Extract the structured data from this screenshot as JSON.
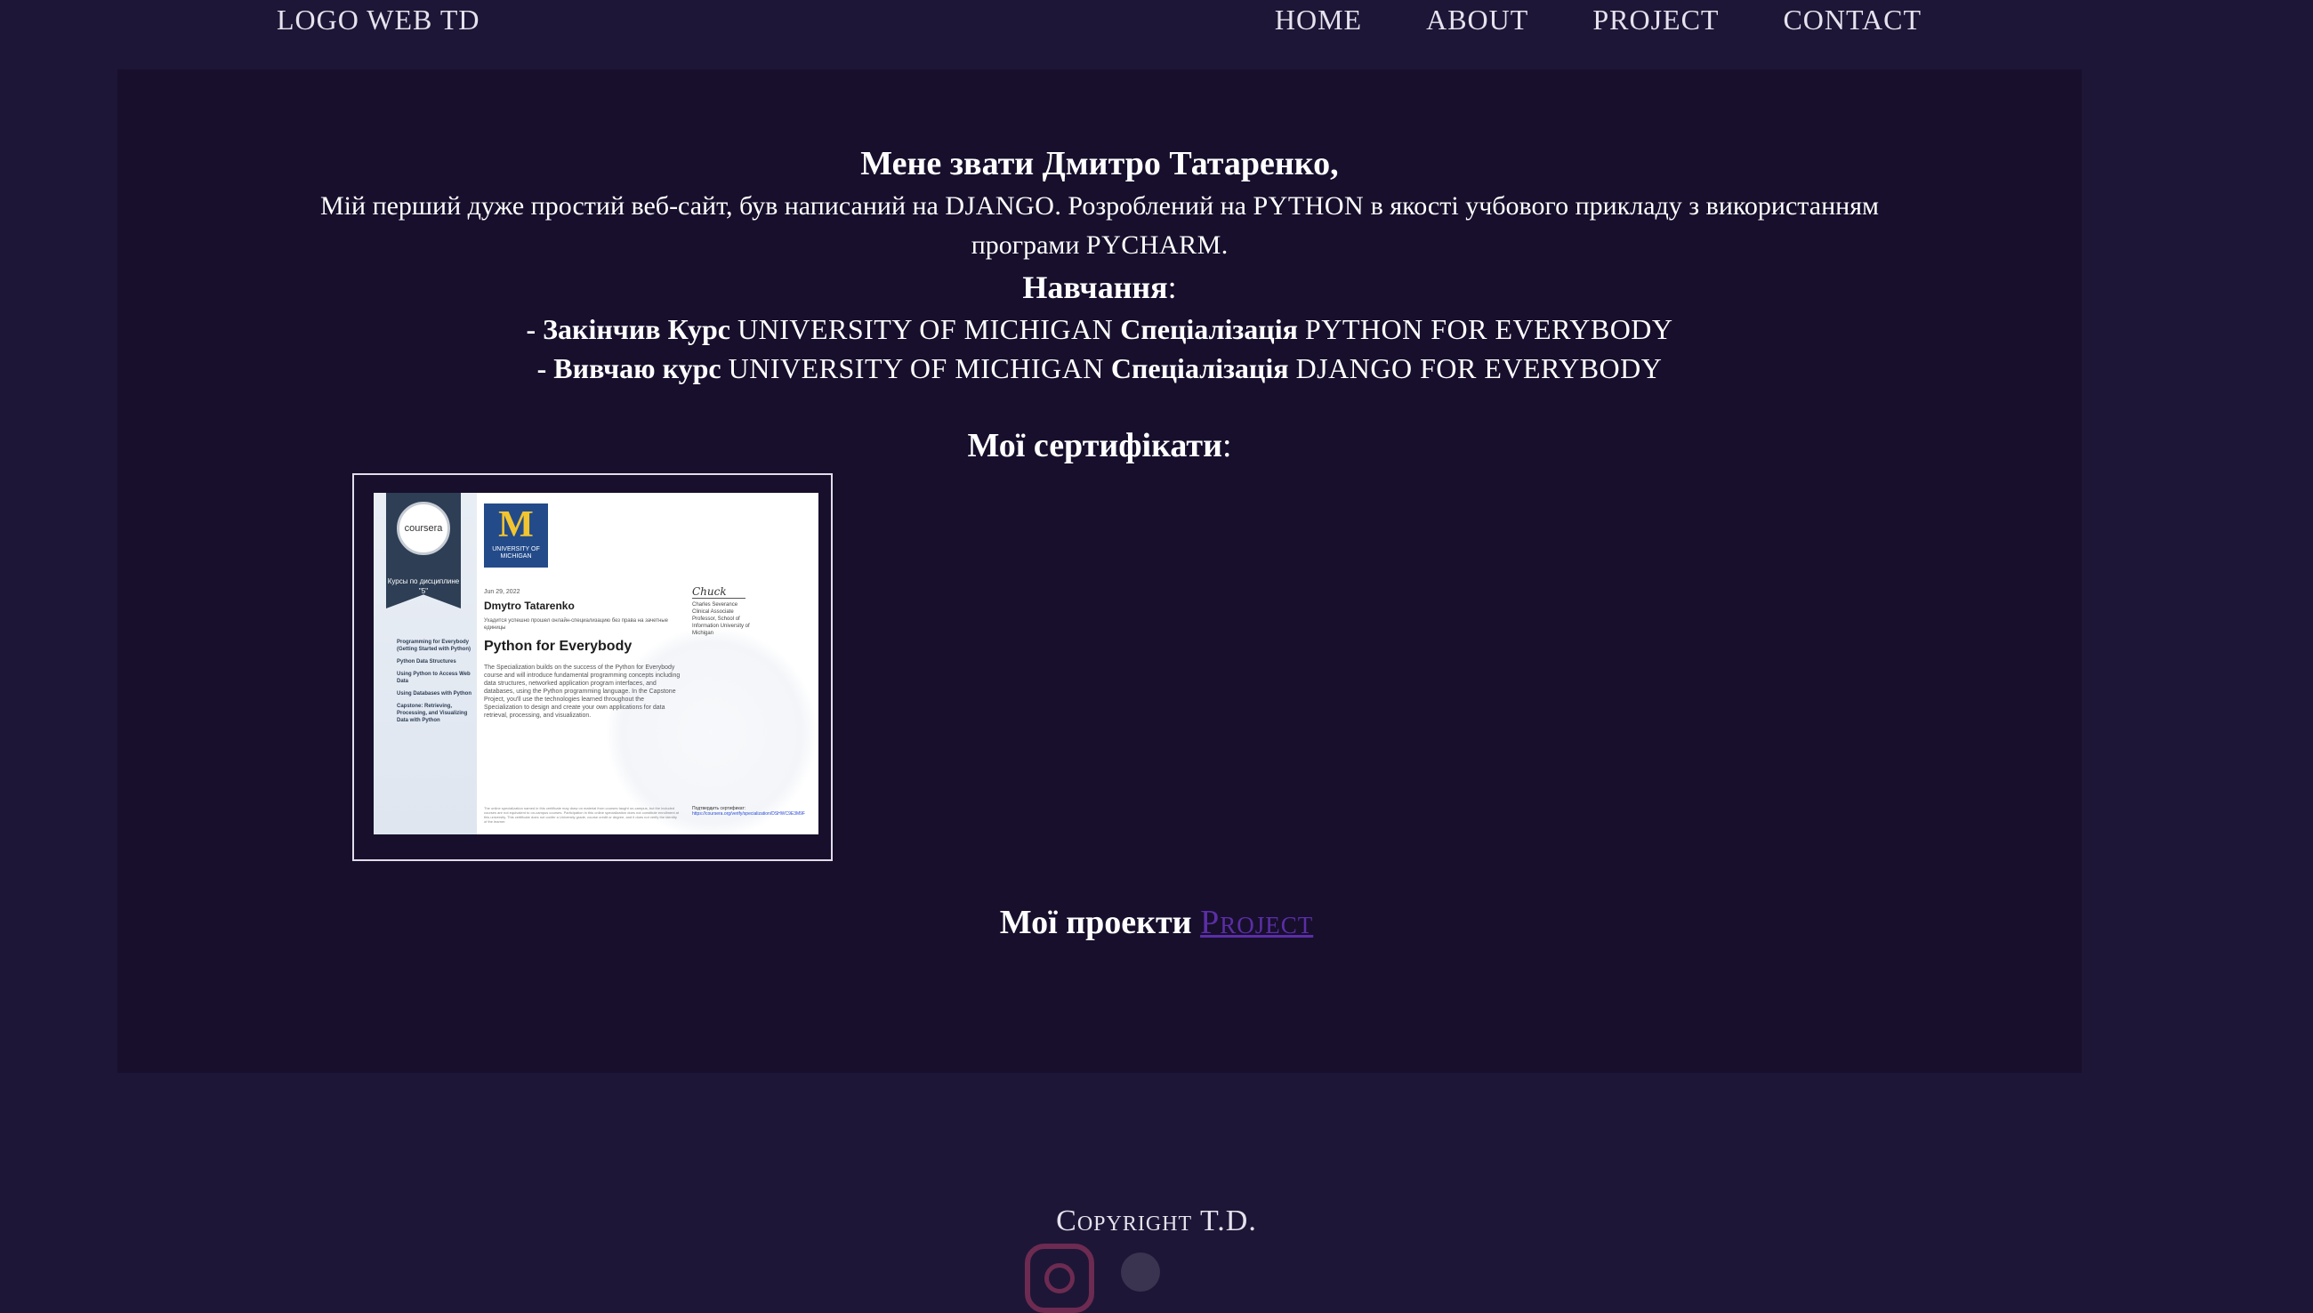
{
  "nav": {
    "logo": "LOGO WEB TD",
    "links": [
      "HOME",
      "ABOUT",
      "PROJECT",
      "CONTACT"
    ]
  },
  "intro": {
    "name_line": "Мене звати Дмитро Татаренко,",
    "desc_part1": "Мій перший дуже простий веб-сайт, був написаний на ",
    "desc_django": "DJANGO",
    "desc_part2": ". Розроблений на ",
    "desc_python": "PYTHON",
    "desc_part3": " в якості учбового прикладу з використанням програми ",
    "desc_pycharm": "PYCHARM",
    "desc_end": ".",
    "study_title": "Навчання",
    "study_colon": ":",
    "course1_prefix": "- Закінчив Курс ",
    "course1_uni": "UNIVERSITY OF MICHIGAN",
    "course1_spec": " Спеціалізація ",
    "course1_name": "PYTHON FOR EVERYBODY",
    "course2_prefix": "- Вивчаю курс ",
    "course2_uni": "UNIVERSITY OF MICHIGAN",
    "course2_spec": " Спеціалізація ",
    "course2_name": "DJANGO FOR EVERYBODY"
  },
  "certificates": {
    "title": "Мої сертифікати",
    "colon": ":",
    "cert": {
      "seal_text": "coursera",
      "ribbon_text": "Курсы по дисциплине \"5\"",
      "courses": [
        "Programming for Everybody (Getting Started with Python)",
        "Python Data Structures",
        "Using Python to Access Web Data",
        "Using Databases with Python",
        "Capstone: Retrieving, Processing, and Visualizing Data with Python"
      ],
      "logo_letter": "M",
      "logo_text": "UNIVERSITY OF MICHIGAN",
      "date": "Jun 29, 2022",
      "person": "Dmytro Tatarenko",
      "subtitle": "Ухадится успешно прошел онлайн-специализацию без права на зачетные единицы",
      "course": "Python for Everybody",
      "body": "The Specialization builds on the success of the Python for Everybody course and will introduce fundamental programming concepts including data structures, networked application program interfaces, and databases, using the Python programming language. In the Capstone Project, you'll use the technologies learned throughout the Specialization to design and create your own applications for data retrieval, processing, and visualization.",
      "signature": "Chuck",
      "signer": "Charles Severance Clinical Associate Professor, School of Information University of Michigan",
      "footer": "The online specialization named in this certificate may draw on material from courses taught on-campus, but the included courses are not equivalent to on-campus courses. Participation in this online specialization does not constitute enrollment at this university. This certificate does not confer a University grade, course credit or degree, and it does not verify the identity of the learner.",
      "verify_label": "Подтвердить сертификат:",
      "verify_link": "https://coursera.org/verify/specialization/DSHWC9E3M9F"
    }
  },
  "projects": {
    "label": "Мої проекти",
    "link": "Project"
  },
  "footer": {
    "copyright": "Copyright T.D."
  }
}
